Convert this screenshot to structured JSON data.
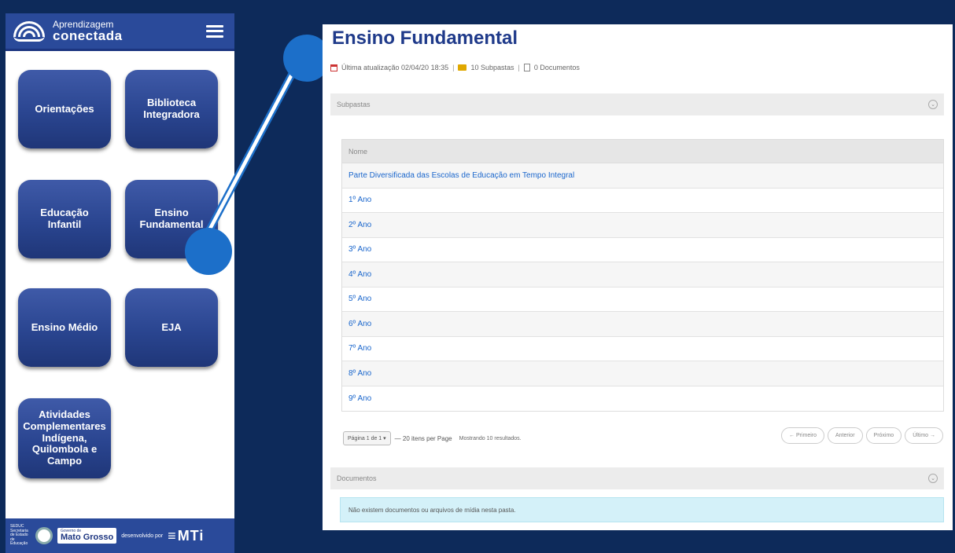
{
  "phone": {
    "logo_small": "Aprendizagem",
    "logo_big": "conectada",
    "tiles": [
      {
        "label": "Orientações"
      },
      {
        "label": "Biblioteca Integradora"
      },
      {
        "label": "Educação Infantil"
      },
      {
        "label": "Ensino Fundamental"
      },
      {
        "label": "Ensino Médio"
      },
      {
        "label": "EJA"
      },
      {
        "label": "Atividades Complementares Indígena, Quilombola e Campo"
      }
    ],
    "footer": {
      "secretaria": "SEDUC Secretaria de Estado de Educação",
      "state_small": "Governo de",
      "state": "Mato Grosso",
      "developed_by": "desenvolvido por",
      "brand": "MTi"
    }
  },
  "page": {
    "title": "Ensino Fundamental",
    "meta": {
      "updated": "Última atualização 02/04/20 18:35",
      "subfolders": "10 Subpastas",
      "documents": "0 Documentos",
      "separator": "|"
    },
    "subfolders_section": "Subpastas",
    "table_header": "Nome",
    "rows": [
      "Parte Diversificada das Escolas de Educação em Tempo Integral",
      "1º Ano",
      "2º Ano",
      "3º Ano",
      "4º Ano",
      "5º Ano",
      "6º Ano",
      "7º Ano",
      "8º Ano",
      "9º Ano"
    ],
    "pager": {
      "page_select": "Página 1 de 1 ▾",
      "per_page": "— 20 itens per Page",
      "showing": "Mostrando 10 resultados."
    },
    "nav": {
      "first": "← Primeiro",
      "previous": "Anterior",
      "next": "Próximo",
      "last": "Último →"
    },
    "documents_section": "Documentos",
    "empty_message": "Não existem documentos ou arquivos de mídia nesta pasta."
  },
  "colors": {
    "background": "#0d2a5a",
    "brand_blue": "#2a4a9a",
    "link": "#1a66cc",
    "connector": "#1c6fc9"
  }
}
